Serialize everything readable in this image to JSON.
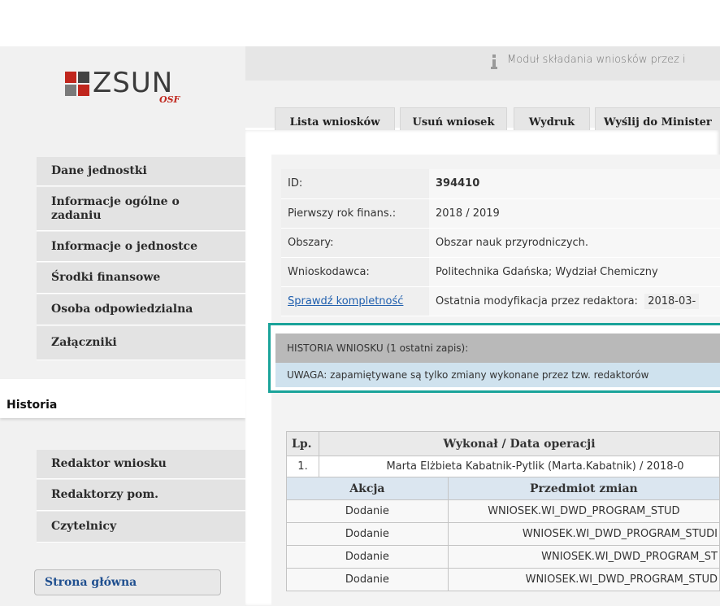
{
  "logo": {
    "text": "ZSUN",
    "sub": "OSF"
  },
  "topbar": {
    "text": "Moduł składania wniosków przez i"
  },
  "toolbar": {
    "buttons": [
      "Lista wniosków",
      "Usuń wniosek",
      "Wydruk",
      "Wyślij do Minister"
    ]
  },
  "sidebar": {
    "items": [
      "Dane jednostki",
      "Informacje ogólne o zadaniu",
      "Informacje o jednostce",
      "Środki finansowe",
      "Osoba odpowiedzialna",
      "Załączniki"
    ],
    "active_tab": "Historia",
    "items2": [
      "Redaktor wniosku",
      "Redaktorzy pom.",
      "Czytelnicy"
    ],
    "home": "Strona główna"
  },
  "details": {
    "id_label": "ID:",
    "id_value": "394410",
    "year_label": "Pierwszy rok finans.:",
    "year_value": "2018 / 2019",
    "area_label": "Obszary:",
    "area_value": "Obszar nauk przyrodniczych.",
    "applicant_label": "Wnioskodawca:",
    "applicant_value": "Politechnika Gdańska; Wydział Chemiczny",
    "check_link": "Sprawdź kompletność",
    "modified_label": "Ostatnia modyfikacja przez redaktora:",
    "modified_value": "2018-03-"
  },
  "history": {
    "header": "HISTORIA WNIOSKU (1 ostatni zapis):",
    "note": "UWAGA: zapamiętywane są tylko zmiany wykonane przez tzw. redaktorów"
  },
  "hist_table": {
    "col_lp": "Lp.",
    "col_who": "Wykonał / Data operacji",
    "entry_no": "1.",
    "entry_who": "Marta Elżbieta Kabatnik-Pytlik (Marta.Kabatnik) / 2018-0",
    "col_action": "Akcja",
    "col_subject": "Przedmiot zmian",
    "rows": [
      {
        "action": "Dodanie",
        "subject": "WNIOSEK.WI_DWD_PROGRAM_STUD"
      },
      {
        "action": "Dodanie",
        "subject": "WNIOSEK.WI_DWD_PROGRAM_STUDI"
      },
      {
        "action": "Dodanie",
        "subject": "WNIOSEK.WI_DWD_PROGRAM_ST"
      },
      {
        "action": "Dodanie",
        "subject": "WNIOSEK.WI_DWD_PROGRAM_STUD"
      }
    ]
  },
  "colors": {
    "accent": "#1aa39a",
    "link": "#1f5fae",
    "logo_red": "#c0261d"
  }
}
